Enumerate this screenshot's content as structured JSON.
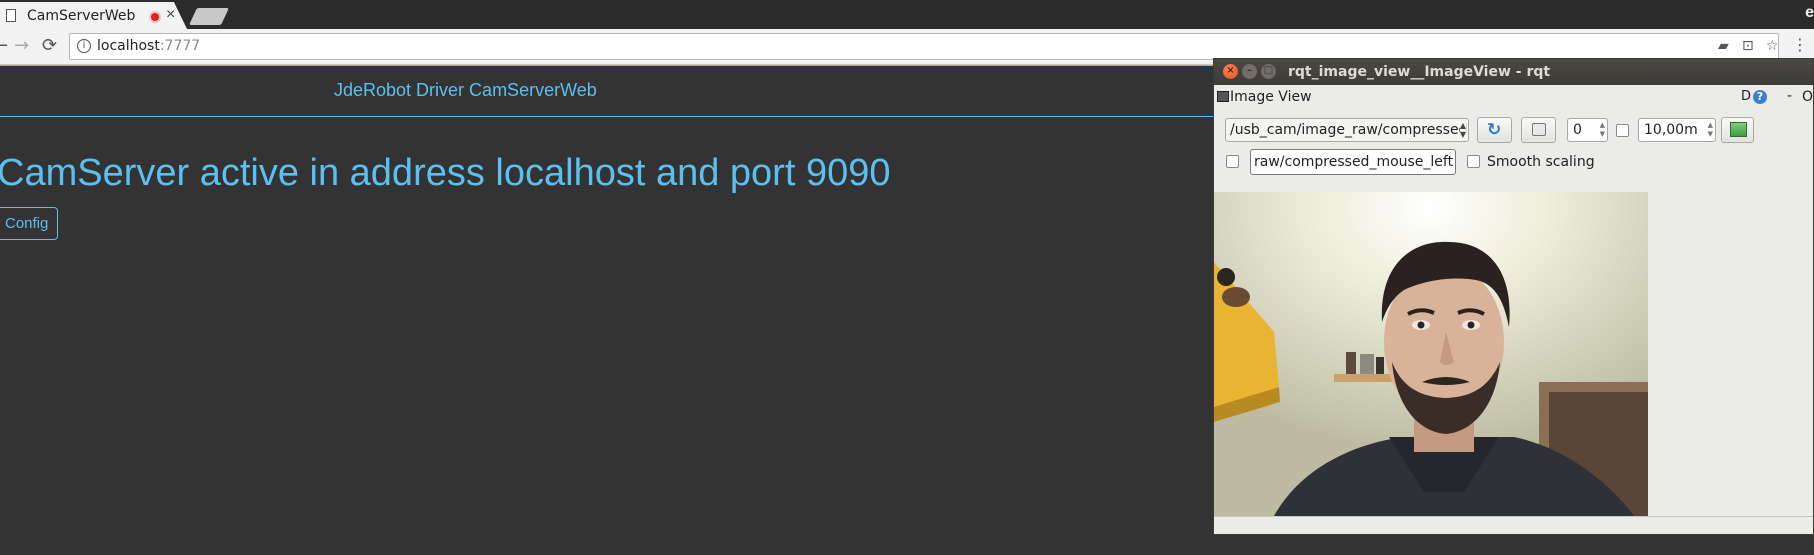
{
  "browser": {
    "tab": {
      "title": "CamServerWeb",
      "close_glyph": "×"
    },
    "url": {
      "host": "localhost",
      "port": ":7777"
    },
    "nav": {
      "back": "←",
      "forward": "→",
      "reload": "⟳"
    },
    "icons": [
      "document-icon",
      "recording-icon",
      "info-icon",
      "camera-icon",
      "translate-icon",
      "star-icon",
      "menu-icon"
    ],
    "corner_glyph": "e"
  },
  "page": {
    "brand": "JdeRobot Driver CamServerWeb",
    "headline": "CamServer active in address localhost and port 9090",
    "config_button": "Config",
    "accent_color": "#5bc0f0",
    "background_color": "#333333"
  },
  "rqt_window": {
    "title": "rqt_image_view__ImageView - rqt",
    "window_buttons": {
      "close": "×",
      "minimize": "–",
      "maximize": "□"
    },
    "plugin_title": "Image View",
    "plugin_actions": {
      "d": "D",
      "help": "?",
      "dash": "-",
      "o": "O"
    },
    "topic_combo": "/usb_cam/image_raw/compressed",
    "spin_value": "0",
    "zoom_value": "10,00m",
    "mouse_topic": "raw/compressed_mouse_left",
    "smooth_scaling_label": "Smooth scaling",
    "checkboxes": {
      "dynamic_range": false,
      "publish_mouse": false,
      "smooth_scaling": false
    }
  }
}
